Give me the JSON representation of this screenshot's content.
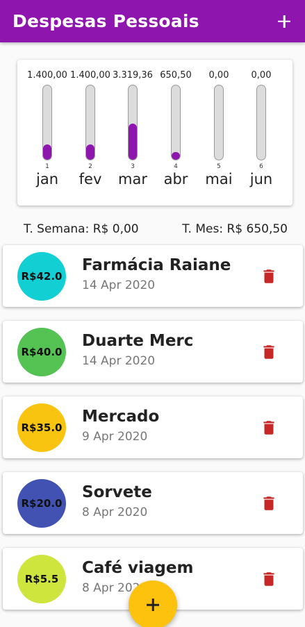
{
  "appbar": {
    "title": "Despesas Pessoais",
    "add_icon": "plus-icon"
  },
  "colors": {
    "primary": "#8e16ae",
    "accent": "#fcc20e",
    "delete": "#c62828",
    "bar_track": "#dcdcdc"
  },
  "chart_data": {
    "type": "bar",
    "categories": [
      "jan",
      "fev",
      "mar",
      "abr",
      "mai",
      "jun"
    ],
    "indices": [
      "1",
      "2",
      "3",
      "4",
      "5",
      "6"
    ],
    "labels": [
      "1.400,00",
      "1.400,00",
      "3.319,36",
      "650,50",
      "0,00",
      "0,00"
    ],
    "values": [
      1400.0,
      1400.0,
      3319.36,
      650.5,
      0.0,
      0.0
    ],
    "fill_fraction": [
      0.21,
      0.21,
      0.49,
      0.1,
      0.0,
      0.0
    ]
  },
  "totals": {
    "week": "T. Semana: R$ 0,00",
    "month": "T. Mes: R$ 650,50"
  },
  "expenses": [
    {
      "amount": "R$42.0",
      "title": "Farmácia Raiane",
      "date": "14 Apr 2020",
      "color": "#12cfd3"
    },
    {
      "amount": "R$40.0",
      "title": "Duarte Merc",
      "date": "14 Apr 2020",
      "color": "#55c254"
    },
    {
      "amount": "R$35.0",
      "title": "Mercado",
      "date": "9 Apr 2020",
      "color": "#f8c40f"
    },
    {
      "amount": "R$20.0",
      "title": "Sorvete",
      "date": "8 Apr 2020",
      "color": "#4152b3"
    },
    {
      "amount": "R$5.5",
      "title": "Café viagem",
      "date": "8 Apr 2020",
      "color": "#cde53d"
    }
  ],
  "delete_icon": "trash-icon",
  "fab_icon": "plus-icon"
}
